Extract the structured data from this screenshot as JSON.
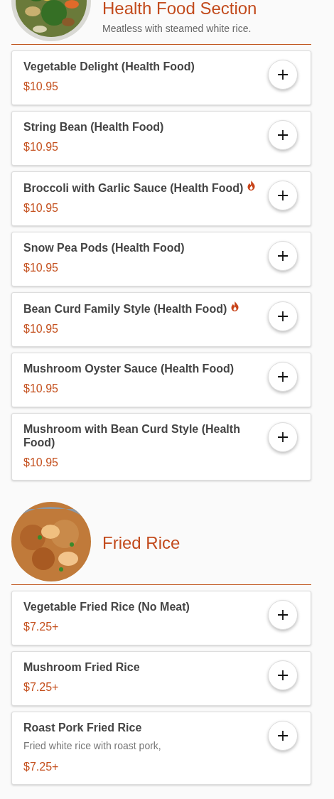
{
  "sections": [
    {
      "title": "Health Food Section",
      "subtitle": "Meatless with steamed white rice.",
      "items": [
        {
          "name": "Vegetable Delight (Health Food)",
          "price": "$10.95",
          "spicy": false
        },
        {
          "name": "String Bean (Health Food)",
          "price": "$10.95",
          "spicy": false
        },
        {
          "name": "Broccoli with Garlic Sauce (Health Food)",
          "price": "$10.95",
          "spicy": true
        },
        {
          "name": "Snow Pea Pods (Health Food)",
          "price": "$10.95",
          "spicy": false
        },
        {
          "name": "Bean Curd Family Style (Health Food)",
          "price": "$10.95",
          "spicy": true
        },
        {
          "name": "Mushroom Oyster Sauce (Health Food)",
          "price": "$10.95",
          "spicy": false
        },
        {
          "name": "Mushroom with Bean Curd Style (Health Food)",
          "price": "$10.95",
          "spicy": false
        }
      ]
    },
    {
      "title": "Fried Rice",
      "items": [
        {
          "name": "Vegetable Fried Rice (No Meat)",
          "price": "$7.25+",
          "spicy": false
        },
        {
          "name": "Mushroom Fried Rice",
          "price": "$7.25+",
          "spicy": false
        },
        {
          "name": "Roast Pork Fried Rice",
          "description": "Fried white rice with roast pork,",
          "price": "$7.25+",
          "spicy": false
        }
      ]
    }
  ]
}
